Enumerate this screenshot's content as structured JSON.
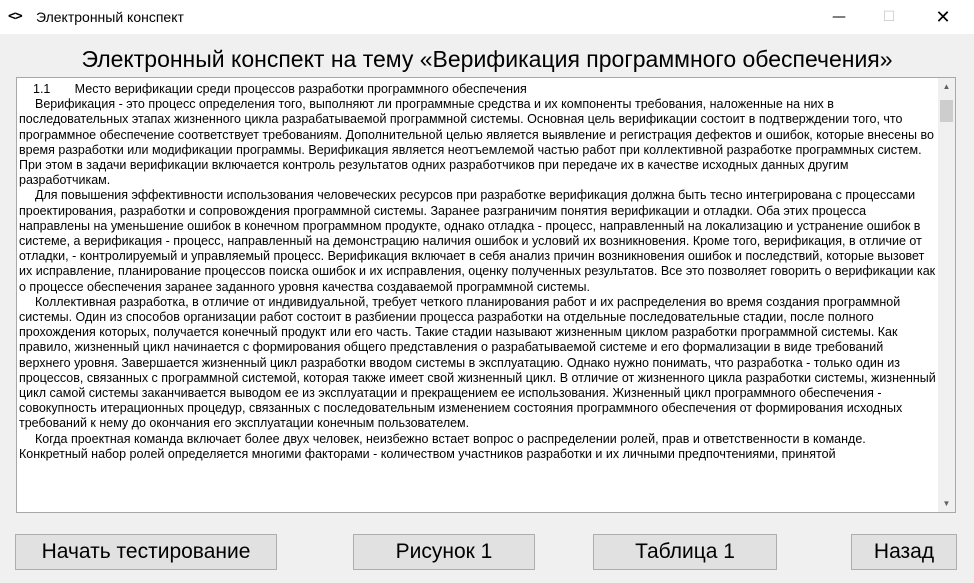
{
  "window": {
    "title": "Электронный конспект",
    "icon": "code-brackets-icon",
    "controls": {
      "minimize": "—",
      "maximize": "☐",
      "close": "✕"
    }
  },
  "heading": "Электронный конспект на тему «Верификация программного обеспечения»",
  "content": {
    "section_title": "1.1       Место верификации среди процессов разработки программного обеспечения",
    "paragraphs": [
      "Верификация - это процесс определения того, выполняют ли программные средства и их компоненты требования, наложенные на них в последовательных этапах жизненного цикла разрабатываемой программной системы. Основная цель верификации состоит в подтверждении того, что программное обеспечение соответствует требованиям. Дополнительной целью является выявление и регистрация дефектов и ошибок, которые внесены во время разработки или модификации программы. Верификация является неотъемлемой частью работ при коллективной разработке программных систем. При этом в задачи верификации включается контроль результатов одних разработчиков при передаче их в качестве исходных данных другим разработчикам.",
      "Для повышения эффективности использования человеческих ресурсов при разработке верификация должна быть тесно интегрирована с процессами проектирования, разработки и сопровождения программной системы. Заранее разграничим понятия верификации и отладки. Оба этих процесса направлены на уменьшение ошибок в конечном программном продукте, однако отладка - процесс, направленный на локализацию и устранение ошибок в системе, а верификация - процесс, направленный на демонстрацию наличия ошибок и условий их возникновения. Кроме того, верификация, в отличие от отладки, - контролируемый и управляемый процесс. Верификация включает в себя анализ причин возникновения ошибок и последствий, которые вызовет их исправление, планирование процессов поиска ошибок и их исправления, оценку полученных результатов. Все это позволяет говорить о верификации как о процессе обеспечения заранее заданного уровня качества создаваемой программной системы.",
      "Коллективная разработка, в отличие от индивидуальной, требует четкого планирования работ и их распределения во время создания программной системы. Один из способов организации работ состоит в разбиении процесса разработки на отдельные последовательные стадии, после полного прохождения которых, получается конечный продукт или его часть. Такие стадии называют жизненным циклом разработки программной системы. Как правило, жизненный цикл начинается с формирования общего представления о разрабатываемой системе и его формализации в виде требований верхнего уровня. Завершается жизненный цикл разработки вводом системы в эксплуатацию. Однако нужно понимать, что разработка - только один из процессов, связанных с программной системой, которая также имеет свой жизненный цикл. В отличие от жизненного цикла разработки системы, жизненный цикл самой системы заканчивается выводом ее из эксплуатации и прекращением ее использования. Жизненный цикл программного обеспечения - совокупность итерационных процедур, связанных с последовательным изменением состояния программного обеспечения от формирования исходных требований к нему до окончания его эксплуатации конечным пользователем.",
      "Когда проектная команда включает более двух человек, неизбежно встает вопрос о распределении ролей, прав и ответственности в команде. Конкретный набор ролей определяется многими факторами - количеством участников разработки и их личными предпочтениями, принятой"
    ]
  },
  "buttons": {
    "start_test": "Начать тестирование",
    "figure1": "Рисунок 1",
    "table1": "Таблица 1",
    "back": "Назад"
  }
}
